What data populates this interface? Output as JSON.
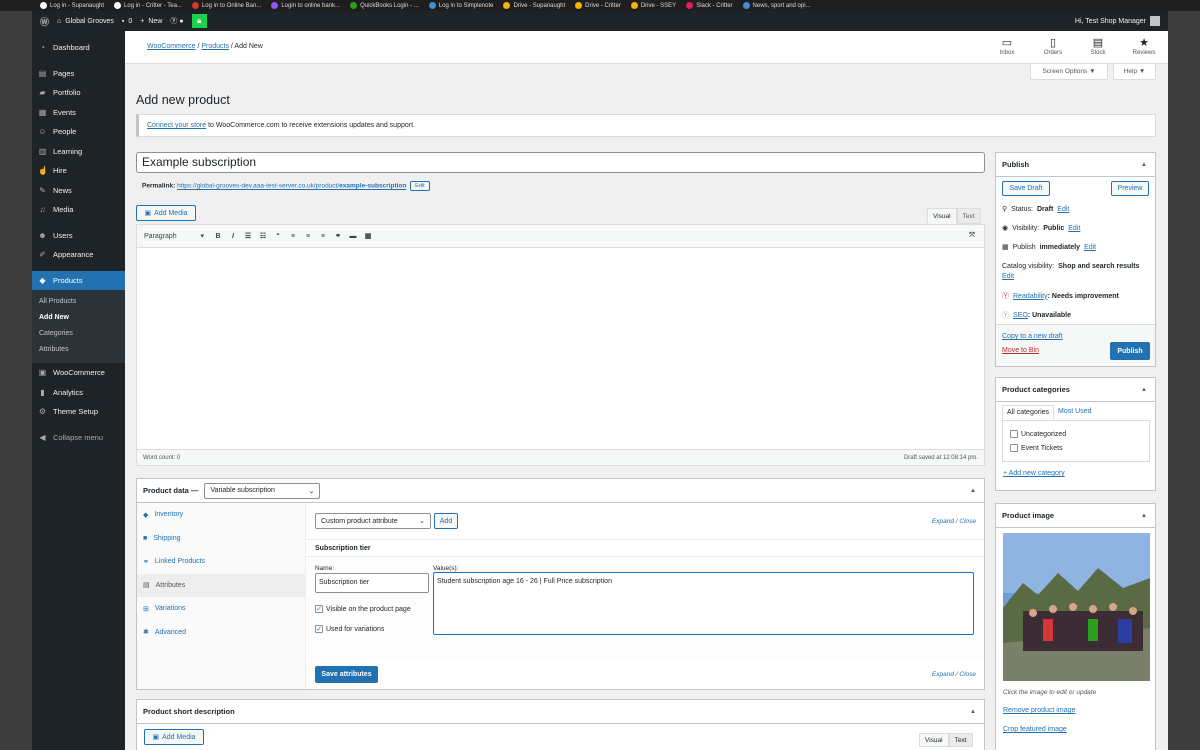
{
  "bookmarks": [
    {
      "label": "Log in - Supanaught",
      "color": "#ffffff"
    },
    {
      "label": "Log in - Critter - Tea...",
      "color": "#ffffff"
    },
    {
      "label": "Log in to Online Ban...",
      "color": "#d63638"
    },
    {
      "label": "Login to online bank...",
      "color": "#8c5cf0"
    },
    {
      "label": "QuickBooks Login - ...",
      "color": "#2ca01c"
    },
    {
      "label": "Log in to Simplenote",
      "color": "#3c8fd9"
    },
    {
      "label": "Drive - Supanaught",
      "color": "#f4b400"
    },
    {
      "label": "Drive - Critter",
      "color": "#f4b400"
    },
    {
      "label": "Drive - SSEY",
      "color": "#f4b400"
    },
    {
      "label": "Slack - Critter",
      "color": "#e01e5a"
    },
    {
      "label": "News, sport and opi...",
      "color": "#3c8fd9"
    }
  ],
  "adminbar": {
    "site": "Global Grooves",
    "comments": "0",
    "new": "New",
    "howdy": "Hi, Test Shop Manager"
  },
  "menu": {
    "dashboard": "Dashboard",
    "pages": "Pages",
    "portfolio": "Portfolio",
    "events": "Events",
    "people": "People",
    "learning": "Learning",
    "hire": "Hire",
    "news": "News",
    "media": "Media",
    "users": "Users",
    "appearance": "Appearance",
    "products": "Products",
    "sub_all": "All Products",
    "sub_add": "Add New",
    "sub_categories": "Categories",
    "sub_attributes": "Attributes",
    "woocommerce": "WooCommerce",
    "analytics": "Analytics",
    "theme_setup": "Theme Setup",
    "collapse": "Collapse menu"
  },
  "header": {
    "crumb_woo": "WooCommerce",
    "crumb_products": "Products",
    "crumb_current": "Add New",
    "inbox": "Inbox",
    "orders": "Orders",
    "stock": "Stock",
    "reviews": "Reviews",
    "screen_options": "Screen Options ▼",
    "help": "Help ▼"
  },
  "page": {
    "title": "Add new product",
    "notice_link": "Connect your store",
    "notice_text": " to WooCommerce.com to receive extensions updates and support.",
    "product_title": "Example subscription",
    "permalink_label": "Permalink:",
    "permalink_base": "https://global-grooves-dev.aaa-test-server.co.uk/product/",
    "permalink_slug": "example-subscription",
    "edit": "Edit"
  },
  "editor": {
    "add_media": "Add Media",
    "tab_visual": "Visual",
    "tab_text": "Text",
    "format": "Paragraph",
    "word_count": "Word count: 0",
    "draft_saved": "Draft saved at 12:08:14 pm."
  },
  "product_data": {
    "label": "Product data —",
    "type": "Variable subscription",
    "tabs": [
      "Inventory",
      "Shipping",
      "Linked Products",
      "Attributes",
      "Variations",
      "Advanced"
    ],
    "attr_select": "Custom product attribute",
    "add": "Add",
    "expand_close": "Expand / Close",
    "attr_name_heading": "Subscription tier",
    "name_label": "Name:",
    "values_label": "Value(s):",
    "name_value": "Subscription tier",
    "values_value": "Student subscription age 16 - 26 | Full Price subscription",
    "visible": "Visible on the product page",
    "variations": "Used for variations",
    "save": "Save attributes"
  },
  "short_desc": {
    "title": "Product short description",
    "add_media": "Add Media",
    "tab_visual": "Visual",
    "tab_text": "Text"
  },
  "publish": {
    "title": "Publish",
    "save_draft": "Save Draft",
    "preview": "Preview",
    "status_label": "Status:",
    "status": "Draft",
    "visibility_label": "Visibility:",
    "visibility": "Public",
    "publish_label": "Publish",
    "publish_when": "immediately",
    "edit": "Edit",
    "catalog_label": "Catalog visibility:",
    "catalog": "Shop and search results",
    "readability": "Readability",
    "readability_val": ": Needs improvement",
    "seo": "SEO",
    "seo_val": ": Unavailable",
    "copy": "Copy to a new draft",
    "bin": "Move to Bin",
    "publish_btn": "Publish"
  },
  "categories": {
    "title": "Product categories",
    "all": "All categories",
    "most_used": "Most Used",
    "items": [
      "Uncategorized",
      "Event Tickets"
    ],
    "add_new": "+ Add new category"
  },
  "product_image": {
    "title": "Product image",
    "hint": "Click the image to edit or update",
    "remove": "Remove product image",
    "crop": "Crop featured image"
  },
  "colors": {
    "accent": "#2271b1",
    "menu_bg": "#1d2327",
    "publish_red": "#b32d2e"
  }
}
